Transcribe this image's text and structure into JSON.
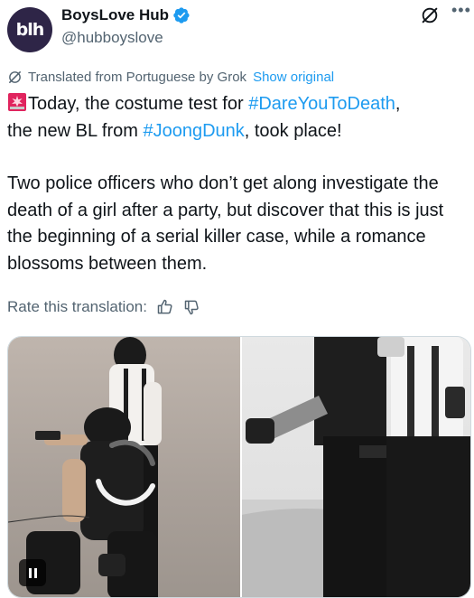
{
  "author": {
    "display_name": "BoysLove Hub",
    "handle": "@hubboyslove",
    "avatar_text": "blh",
    "avatar_color": "#2e2547",
    "verified_color": "#1d9bf0"
  },
  "translation": {
    "notice": "Translated from Portuguese by Grok",
    "show_original": "Show original"
  },
  "tweet": {
    "line1_before": "Today, the costume test for ",
    "hashtag1": "#DareYouToDeath",
    "line1_after": ",",
    "line2_before": "the new BL from ",
    "hashtag2": "#JoongDunk",
    "line2_after": ", took place!",
    "paragraph2": "Two police officers who don’t get along investigate the death of a girl after a party, but discover that this is just the beginning of a serial killer case, while a romance blossoms between them."
  },
  "rate": {
    "label": "Rate this translation:"
  },
  "icons": {
    "grok": "grok-icon",
    "more": "more-icon",
    "siren": "siren-icon",
    "thumbs_up": "thumbs-up-icon",
    "thumbs_down": "thumbs-down-icon",
    "pause": "pause-icon"
  },
  "colors": {
    "text": "#0f1419",
    "secondary": "#536471",
    "link": "#1d9bf0"
  }
}
